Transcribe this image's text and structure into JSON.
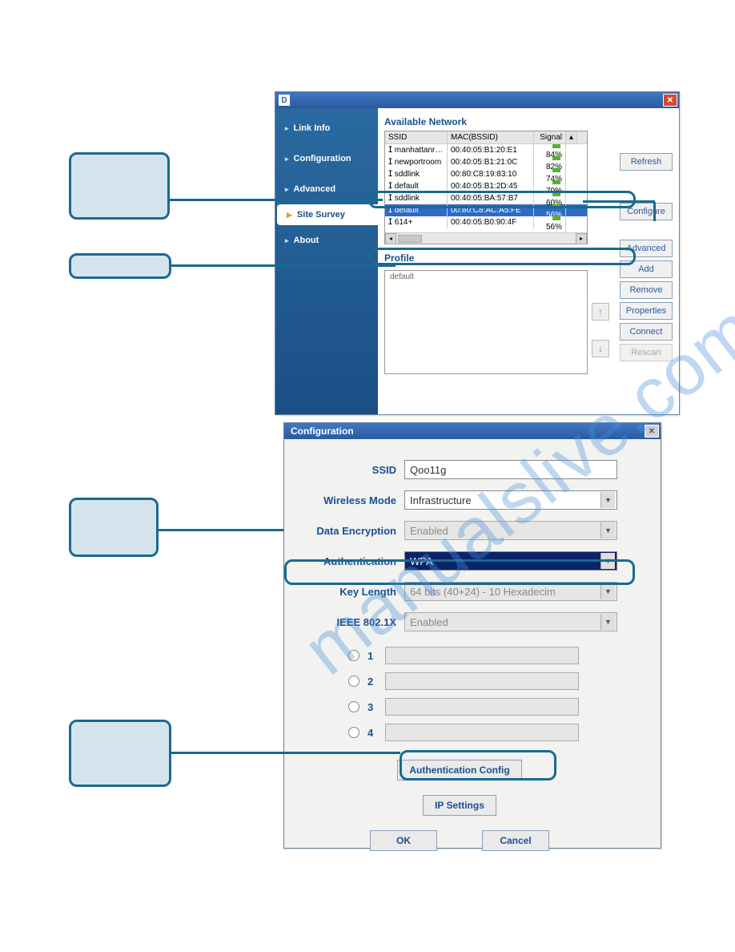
{
  "watermark": "manualslive.com",
  "win1": {
    "iconLetter": "D",
    "nav": [
      "Link Info",
      "Configuration",
      "Advanced",
      "Site Survey",
      "About"
    ],
    "activeNavIndex": 3,
    "availableTitle": "Available Network",
    "columns": {
      "ssid": "SSID",
      "mac": "MAC(BSSID)",
      "signal": "Signal"
    },
    "rows": [
      {
        "ssid": "manhattanr…",
        "mac": "00:40:05:B1:20:E1",
        "signal": "84%"
      },
      {
        "ssid": "newportroom",
        "mac": "00:40:05:B1:21:0C",
        "signal": "82%"
      },
      {
        "ssid": "sddlink",
        "mac": "00:80:C8:19:83:10",
        "signal": "74%"
      },
      {
        "ssid": "default",
        "mac": "00:40:05:B1:2D:45",
        "signal": "70%"
      },
      {
        "ssid": "sddlink",
        "mac": "00:40:05:BA:57:B7",
        "signal": "60%"
      },
      {
        "ssid": "default",
        "mac": "00:80:C8:AC:A5:FE",
        "signal": "56%",
        "selected": true
      },
      {
        "ssid": "614+",
        "mac": "00:40:05:B0:90:4F",
        "signal": "56%"
      }
    ],
    "profileTitle": "Profile",
    "profileItem": "default",
    "buttons": {
      "refresh": "Refresh",
      "configure": "Configure",
      "advanced": "Advanced",
      "add": "Add",
      "remove": "Remove",
      "properties": "Properties",
      "connect": "Connect",
      "rescan": "Rescan"
    }
  },
  "win2": {
    "title": "Configuration",
    "labels": {
      "ssid": "SSID",
      "wmode": "Wireless Mode",
      "enc": "Data Encryption",
      "auth": "Authentication",
      "klen": "Key Length",
      "ieee": "IEEE 802.1X"
    },
    "values": {
      "ssid": "Qoo11g",
      "wmode": "Infrastructure",
      "enc": "Enabled",
      "auth": "WPA",
      "klen": "64 bits (40+24) - 10 Hexadecim",
      "ieee": "Enabled"
    },
    "keys": [
      "1",
      "2",
      "3",
      "4"
    ],
    "buttons": {
      "authcfg": "Authentication Config",
      "ipset": "IP Settings",
      "ok": "OK",
      "cancel": "Cancel"
    }
  }
}
